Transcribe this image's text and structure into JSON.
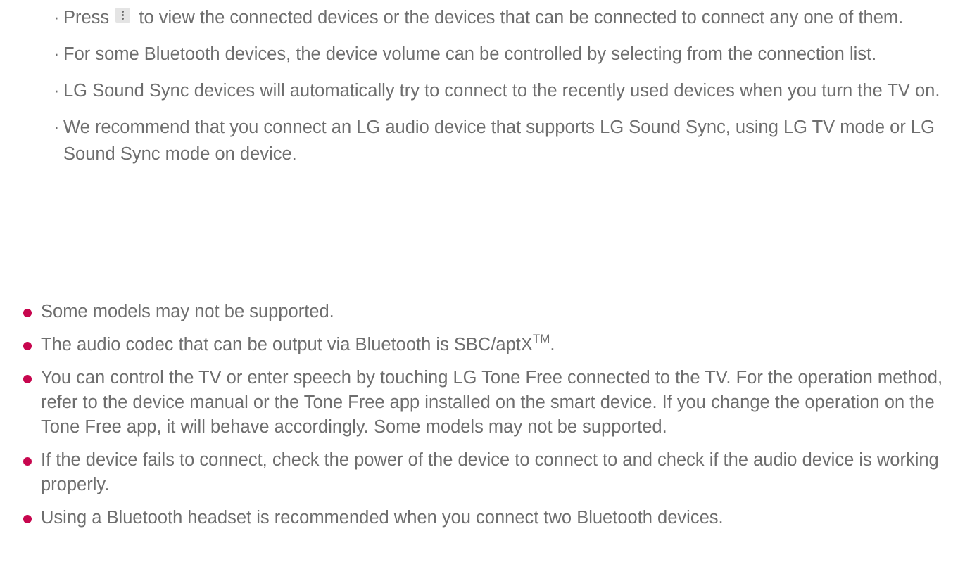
{
  "colors": {
    "text": "#6e6e6e",
    "bullet": "#c7064e",
    "icon_bg": "#e4e4e4"
  },
  "sub_marker": "·",
  "sub_items": [
    {
      "before_icon": "Press",
      "icon": "more-options-icon",
      "text": "to view the connected devices or the devices that can be connected to connect any one of them."
    },
    {
      "text": "For some Bluetooth devices, the device volume can be controlled by selecting from the connection list."
    },
    {
      "text": "LG Sound Sync devices will automatically try to connect to the recently used devices when you turn the TV on."
    },
    {
      "text": "We recommend that you connect an LG audio device that supports LG Sound Sync, using LG TV mode or LG Sound Sync mode on device."
    }
  ],
  "bullets": [
    {
      "text": "Some models may not be supported."
    },
    {
      "text": "The audio codec that can be output via Bluetooth is SBC/aptX",
      "sup": "TM",
      "after": "."
    },
    {
      "text": "You can control the TV or enter speech by touching LG Tone Free connected to the TV. For the operation method, refer to the device manual or the Tone Free app installed on the smart device. If you change the operation on the Tone Free app, it will behave accordingly. Some models may not be supported."
    },
    {
      "text": "If the device fails to connect, check the power of the device to connect to and check if the audio device is working properly."
    },
    {
      "text": "Using a Bluetooth headset is recommended when you connect two Bluetooth devices."
    }
  ]
}
